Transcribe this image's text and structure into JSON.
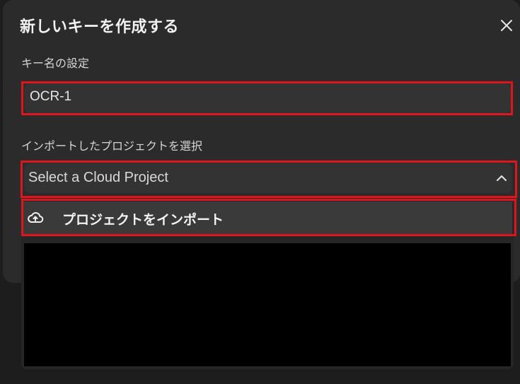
{
  "dialog": {
    "title": "新しいキーを作成する",
    "close_icon": "close-icon"
  },
  "key_name": {
    "label": "キー名の設定",
    "value": "OCR-1"
  },
  "project": {
    "label": "インポートしたプロジェクトを選択",
    "placeholder": "Select a Cloud Project",
    "chevron_icon": "chevron-up-icon",
    "menu": {
      "import_label": "プロジェクトをインポート",
      "import_icon": "cloud-upload-icon"
    }
  },
  "colors": {
    "highlight": "#e0141c",
    "dialog_bg": "#2b2b2b"
  }
}
